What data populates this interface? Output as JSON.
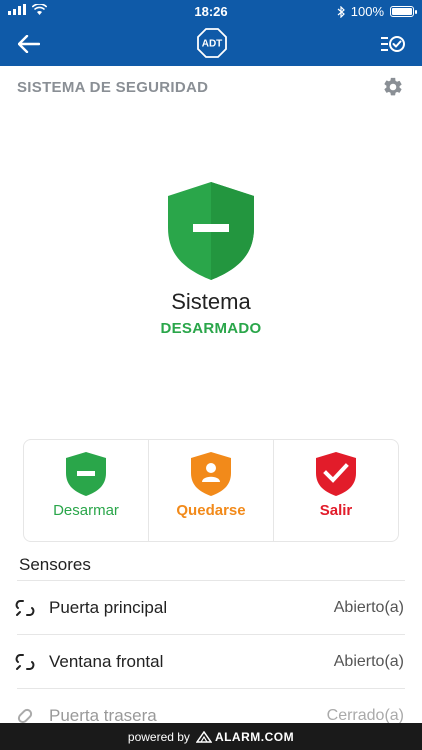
{
  "statusbar": {
    "time": "18:26",
    "battery": "100%",
    "signal_icon": "signal-bars-icon",
    "wifi_icon": "wifi-icon",
    "bluetooth_icon": "bluetooth-icon",
    "battery_level": 1.0
  },
  "navbar": {
    "back_icon": "back-arrow-icon",
    "logo": "ADT",
    "right_icon": "checklist-icon",
    "background": "#0f5aa8"
  },
  "section": {
    "title": "SISTEMA DE SEGURIDAD",
    "settings_icon": "gear-icon"
  },
  "system": {
    "name": "Sistema",
    "state": "DESARMADO",
    "state_color": "#2aa64a",
    "shield_icon": "shield-minus-icon"
  },
  "actions": [
    {
      "label": "Desarmar",
      "icon": "shield-minus-icon",
      "color": "#2aa64a"
    },
    {
      "label": "Quedarse",
      "icon": "shield-person-icon",
      "color": "#f28a1a"
    },
    {
      "label": "Salir",
      "icon": "shield-check-icon",
      "color": "#e21c2a"
    }
  ],
  "sensors": {
    "title": "Sensores",
    "items": [
      {
        "name": "Puerta principal",
        "state": "Abierto(a)",
        "icon": "open-link-icon"
      },
      {
        "name": "Ventana frontal",
        "state": "Abierto(a)",
        "icon": "open-link-icon"
      },
      {
        "name": "Puerta trasera",
        "state": "Cerrado(a)",
        "icon": "closed-link-icon"
      }
    ]
  },
  "footer": {
    "powered_by": "powered by",
    "brand": "ALARM.COM"
  }
}
